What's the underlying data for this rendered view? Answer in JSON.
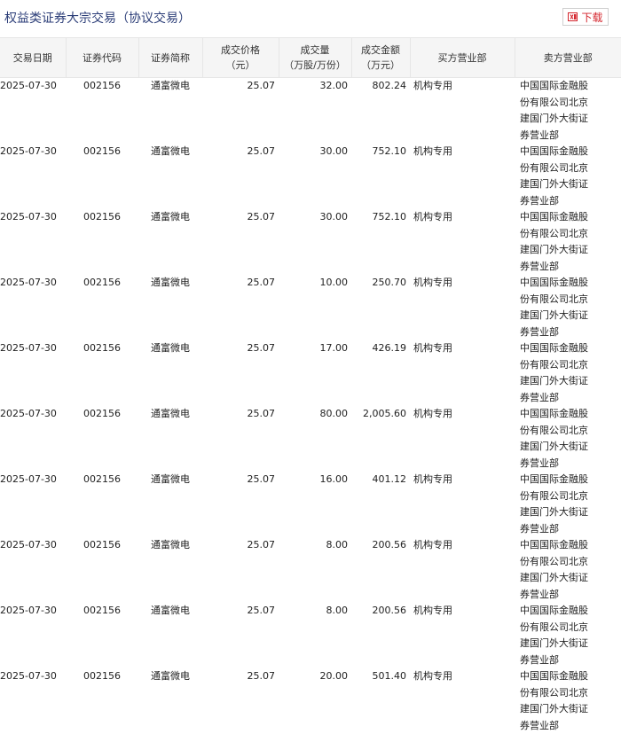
{
  "header": {
    "title": "权益类证券大宗交易（协议交易）",
    "download_label": "下载",
    "download_icon": "excel-icon",
    "accent_color": "#d4262e"
  },
  "table": {
    "columns": [
      "交易日期",
      "证券代码",
      "证券简称",
      "成交价格\n（元）",
      "成交量\n（万股/万份）",
      "成交金额\n（万元）",
      "买方营业部",
      "卖方营业部"
    ],
    "rows": [
      {
        "date": "2025-07-30",
        "code": "002156",
        "name": "通富微电",
        "price": "25.07",
        "volume": "32.00",
        "amount": "802.24",
        "buyer": "机构专用",
        "seller": "中国国际金融股份有限公司北京建国门外大街证券营业部"
      },
      {
        "date": "2025-07-30",
        "code": "002156",
        "name": "通富微电",
        "price": "25.07",
        "volume": "30.00",
        "amount": "752.10",
        "buyer": "机构专用",
        "seller": "中国国际金融股份有限公司北京建国门外大街证券营业部"
      },
      {
        "date": "2025-07-30",
        "code": "002156",
        "name": "通富微电",
        "price": "25.07",
        "volume": "30.00",
        "amount": "752.10",
        "buyer": "机构专用",
        "seller": "中国国际金融股份有限公司北京建国门外大街证券营业部"
      },
      {
        "date": "2025-07-30",
        "code": "002156",
        "name": "通富微电",
        "price": "25.07",
        "volume": "10.00",
        "amount": "250.70",
        "buyer": "机构专用",
        "seller": "中国国际金融股份有限公司北京建国门外大街证券营业部"
      },
      {
        "date": "2025-07-30",
        "code": "002156",
        "name": "通富微电",
        "price": "25.07",
        "volume": "17.00",
        "amount": "426.19",
        "buyer": "机构专用",
        "seller": "中国国际金融股份有限公司北京建国门外大街证券营业部"
      },
      {
        "date": "2025-07-30",
        "code": "002156",
        "name": "通富微电",
        "price": "25.07",
        "volume": "80.00",
        "amount": "2,005.60",
        "buyer": "机构专用",
        "seller": "中国国际金融股份有限公司北京建国门外大街证券营业部"
      },
      {
        "date": "2025-07-30",
        "code": "002156",
        "name": "通富微电",
        "price": "25.07",
        "volume": "16.00",
        "amount": "401.12",
        "buyer": "机构专用",
        "seller": "中国国际金融股份有限公司北京建国门外大街证券营业部"
      },
      {
        "date": "2025-07-30",
        "code": "002156",
        "name": "通富微电",
        "price": "25.07",
        "volume": "8.00",
        "amount": "200.56",
        "buyer": "机构专用",
        "seller": "中国国际金融股份有限公司北京建国门外大街证券营业部"
      },
      {
        "date": "2025-07-30",
        "code": "002156",
        "name": "通富微电",
        "price": "25.07",
        "volume": "8.00",
        "amount": "200.56",
        "buyer": "机构专用",
        "seller": "中国国际金融股份有限公司北京建国门外大街证券营业部"
      },
      {
        "date": "2025-07-30",
        "code": "002156",
        "name": "通富微电",
        "price": "25.07",
        "volume": "20.00",
        "amount": "501.40",
        "buyer": "机构专用",
        "seller": "中国国际金融股份有限公司北京建国门外大街证券营业部"
      }
    ]
  }
}
